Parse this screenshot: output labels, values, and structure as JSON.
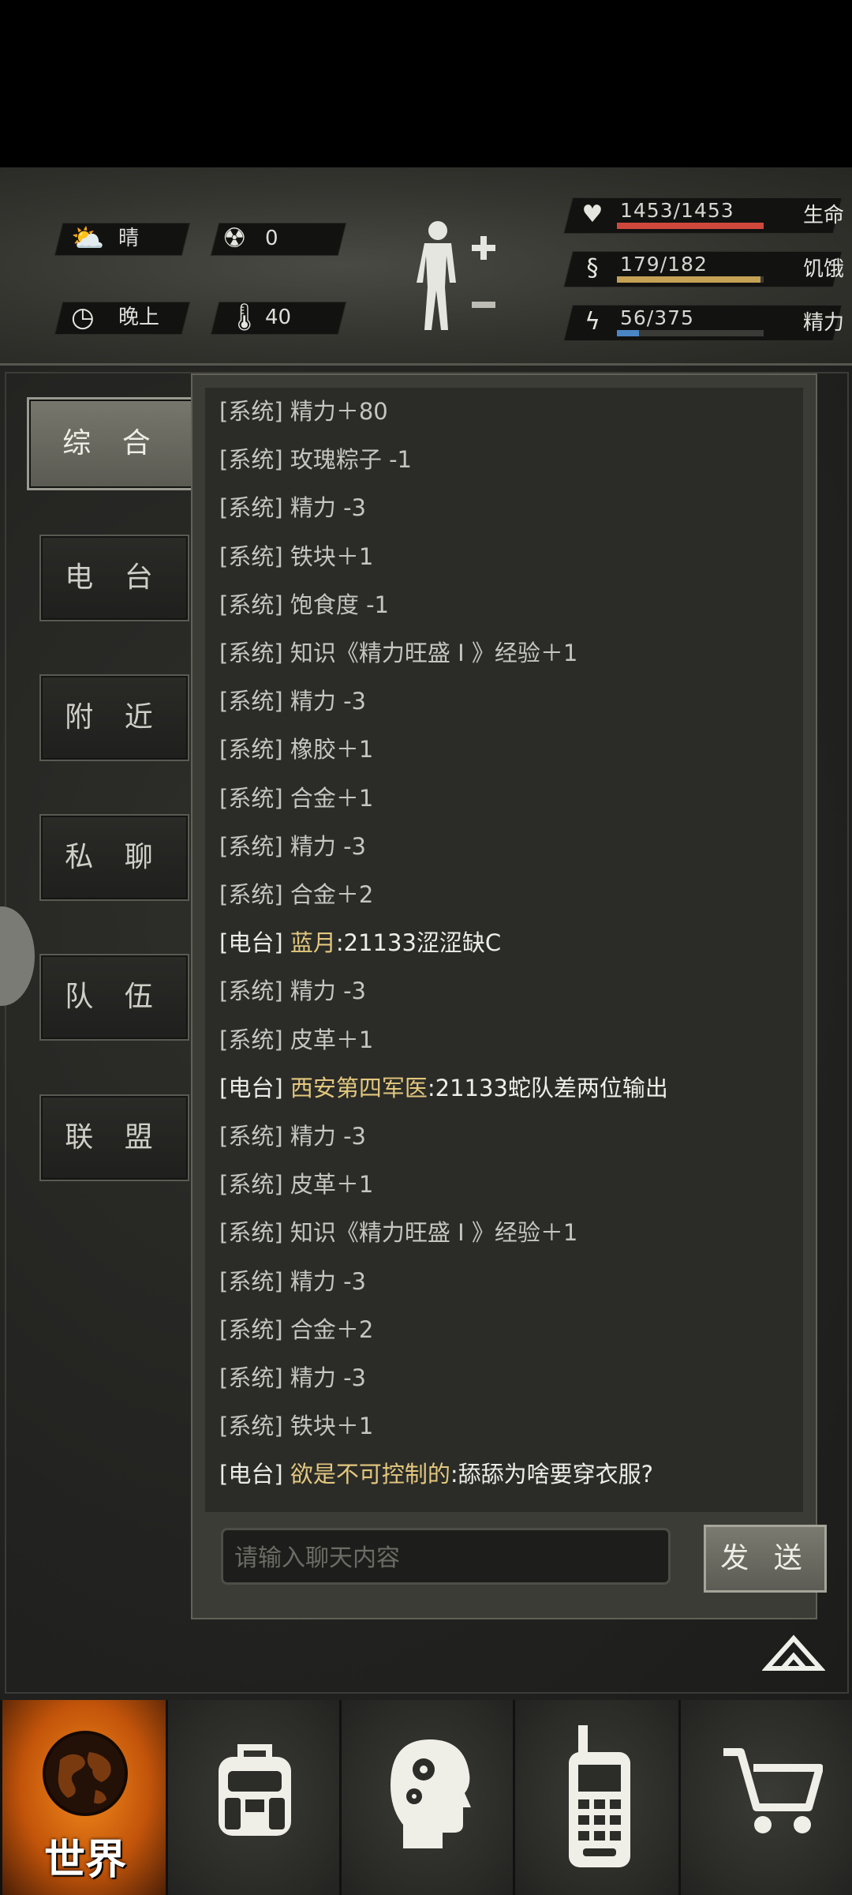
{
  "hud": {
    "weather": "晴",
    "radiation": "0",
    "time_of_day": "晚上",
    "temperature": "40",
    "health": {
      "value": "1453/1453",
      "label": "生命",
      "fraction": 1.0,
      "color": "#d0483c"
    },
    "hunger": {
      "value": "179/182",
      "label": "饥饿",
      "fraction": 0.98,
      "color": "#c4a155"
    },
    "energy": {
      "value": "56/375",
      "label": "精力",
      "fraction": 0.15,
      "color": "#4a86c6"
    }
  },
  "tabs": [
    "综 合",
    "电 台",
    "附 近",
    "私 聊",
    "队 伍",
    "联 盟"
  ],
  "messages": [
    {
      "tag": "[系统]",
      "text": "精力＋80"
    },
    {
      "tag": "[系统]",
      "text": "玫瑰粽子 -1"
    },
    {
      "tag": "[系统]",
      "text": "精力 -3"
    },
    {
      "tag": "[系统]",
      "text": "铁块＋1"
    },
    {
      "tag": "[系统]",
      "text": "饱食度 -1"
    },
    {
      "tag": "[系统]",
      "text": "知识《精力旺盛 I 》经验＋1"
    },
    {
      "tag": "[系统]",
      "text": "精力 -3"
    },
    {
      "tag": "[系统]",
      "text": "橡胶＋1"
    },
    {
      "tag": "[系统]",
      "text": "合金＋1"
    },
    {
      "tag": "[系统]",
      "text": "精力 -3"
    },
    {
      "tag": "[系统]",
      "text": "合金＋2"
    },
    {
      "tag": "[电台]",
      "sender": "蓝月",
      "text": ":21133涩涩缺C"
    },
    {
      "tag": "[系统]",
      "text": "精力 -3"
    },
    {
      "tag": "[系统]",
      "text": "皮革＋1"
    },
    {
      "tag": "[电台]",
      "sender": "西安第四军医",
      "text": ":21133蛇队差两位输出"
    },
    {
      "tag": "[系统]",
      "text": "精力 -3"
    },
    {
      "tag": "[系统]",
      "text": "皮革＋1"
    },
    {
      "tag": "[系统]",
      "text": "知识《精力旺盛 I 》经验＋1"
    },
    {
      "tag": "[系统]",
      "text": "精力 -3"
    },
    {
      "tag": "[系统]",
      "text": "合金＋2"
    },
    {
      "tag": "[系统]",
      "text": "精力 -3"
    },
    {
      "tag": "[系统]",
      "text": "铁块＋1"
    },
    {
      "tag": "[电台]",
      "sender": "欲是不可控制的",
      "text": ":舔舔为啥要穿衣服?"
    }
  ],
  "input": {
    "placeholder": "请输入聊天内容"
  },
  "send_label": "发 送",
  "nav": {
    "world_label": "世界"
  }
}
